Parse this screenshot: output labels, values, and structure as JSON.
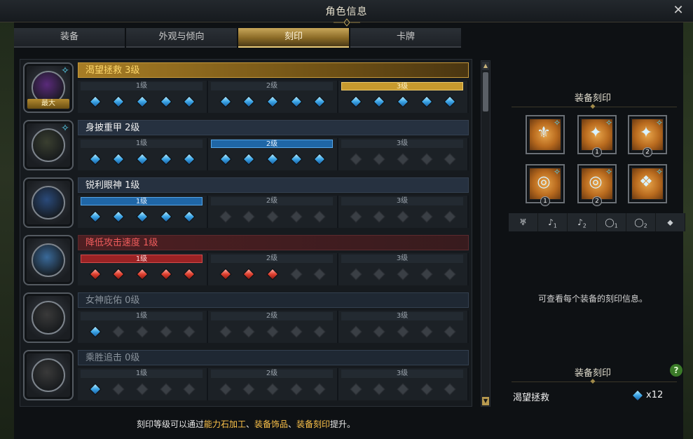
{
  "window": {
    "title": "角色信息"
  },
  "tabs": [
    {
      "label": "装备",
      "active": false
    },
    {
      "label": "外观与倾向",
      "active": false
    },
    {
      "label": "刻印",
      "active": true
    },
    {
      "label": "卡牌",
      "active": false
    }
  ],
  "engravings": [
    {
      "name": "渴望拯救 3级",
      "style": "gold",
      "badge": true,
      "max_label": "最大",
      "levels": [
        {
          "label": "1级",
          "style": "",
          "gems": [
            "blue",
            "blue",
            "blue",
            "blue",
            "blue"
          ]
        },
        {
          "label": "2级",
          "style": "",
          "gems": [
            "blue",
            "blue",
            "blue",
            "blue",
            "blue"
          ]
        },
        {
          "label": "3级",
          "style": "gold",
          "gems": [
            "blue",
            "blue",
            "blue",
            "blue",
            "blue"
          ]
        }
      ]
    },
    {
      "name": "身披重甲 2级",
      "style": "",
      "badge": true,
      "max_label": "",
      "levels": [
        {
          "label": "1级",
          "style": "",
          "gems": [
            "blue",
            "blue",
            "blue",
            "blue",
            "blue"
          ]
        },
        {
          "label": "2级",
          "style": "blue",
          "gems": [
            "blue",
            "blue",
            "blue",
            "blue",
            "blue"
          ]
        },
        {
          "label": "3级",
          "style": "",
          "gems": [
            "empty",
            "empty",
            "empty",
            "empty",
            "empty"
          ]
        }
      ]
    },
    {
      "name": "锐利眼神 1级",
      "style": "",
      "badge": false,
      "max_label": "",
      "levels": [
        {
          "label": "1级",
          "style": "blue",
          "gems": [
            "blue",
            "blue",
            "blue",
            "blue",
            "blue"
          ]
        },
        {
          "label": "2级",
          "style": "",
          "gems": [
            "empty",
            "empty",
            "empty",
            "empty",
            "empty"
          ]
        },
        {
          "label": "3级",
          "style": "",
          "gems": [
            "empty",
            "empty",
            "empty",
            "empty",
            "empty"
          ]
        }
      ]
    },
    {
      "name": "降低攻击速度 1级",
      "style": "red",
      "badge": false,
      "max_label": "",
      "levels": [
        {
          "label": "1级",
          "style": "red",
          "gems": [
            "red",
            "red",
            "red",
            "red",
            "red"
          ]
        },
        {
          "label": "2级",
          "style": "",
          "gems": [
            "red",
            "red",
            "red",
            "empty",
            "empty"
          ]
        },
        {
          "label": "3级",
          "style": "",
          "gems": [
            "empty",
            "empty",
            "empty",
            "empty",
            "empty"
          ]
        }
      ]
    },
    {
      "name": "女神庇佑 0级",
      "style": "dim",
      "badge": false,
      "max_label": "",
      "levels": [
        {
          "label": "1级",
          "style": "",
          "gems": [
            "blue",
            "empty",
            "empty",
            "empty",
            "empty"
          ]
        },
        {
          "label": "2级",
          "style": "",
          "gems": [
            "empty",
            "empty",
            "empty",
            "empty",
            "empty"
          ]
        },
        {
          "label": "3级",
          "style": "",
          "gems": [
            "empty",
            "empty",
            "empty",
            "empty",
            "empty"
          ]
        }
      ]
    },
    {
      "name": "乘胜追击 0级",
      "style": "dim",
      "badge": false,
      "max_label": "",
      "levels": [
        {
          "label": "1级",
          "style": "",
          "gems": [
            "blue",
            "empty",
            "empty",
            "empty",
            "empty"
          ]
        },
        {
          "label": "2级",
          "style": "",
          "gems": [
            "empty",
            "empty",
            "empty",
            "empty",
            "empty"
          ]
        },
        {
          "label": "3级",
          "style": "",
          "gems": [
            "empty",
            "empty",
            "empty",
            "empty",
            "empty"
          ]
        }
      ]
    }
  ],
  "hint": {
    "prefix": "刻印等级可以通过",
    "h1": "能力石加工",
    "sep1": "、",
    "h2": "装备饰品",
    "sep2": "、",
    "h3": "装备刻印",
    "suffix": "提升。"
  },
  "right_panel": {
    "title": "装备刻印",
    "slots": [
      {
        "icon": "necklace-icon",
        "glyph": "⚜",
        "num": "",
        "badge": true
      },
      {
        "icon": "earring-icon",
        "glyph": "✦",
        "num": "1",
        "badge": true
      },
      {
        "icon": "earring-icon",
        "glyph": "✦",
        "num": "2",
        "badge": true
      },
      {
        "icon": "ring-icon",
        "glyph": "◎",
        "num": "1",
        "badge": true
      },
      {
        "icon": "ring-icon",
        "glyph": "◎",
        "num": "2",
        "badge": true
      },
      {
        "icon": "crystal-icon",
        "glyph": "❖",
        "num": "",
        "badge": true
      }
    ],
    "types": [
      {
        "icon": "necklace-filter-icon",
        "glyph": "♅",
        "sub": ""
      },
      {
        "icon": "earring-filter-icon",
        "glyph": "♪",
        "sub": "1"
      },
      {
        "icon": "earring-filter-icon",
        "glyph": "♪",
        "sub": "2"
      },
      {
        "icon": "ring-filter-icon",
        "glyph": "◯",
        "sub": "1"
      },
      {
        "icon": "ring-filter-icon",
        "glyph": "◯",
        "sub": "2"
      },
      {
        "icon": "stone-filter-icon",
        "glyph": "⬥",
        "sub": ""
      }
    ],
    "info": "可查看每个装备的刻印信息。",
    "equipped_title": "装备刻印",
    "equipped_name": "渴望拯救",
    "equipped_count": "x12"
  }
}
